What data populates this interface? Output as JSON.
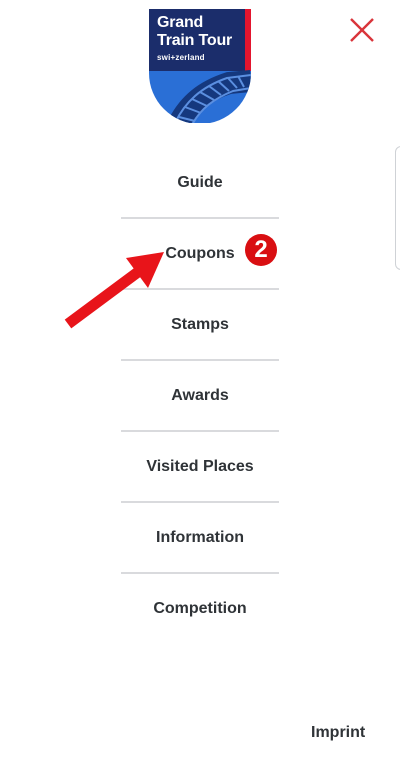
{
  "logo": {
    "line1": "Grand",
    "line2": "Train Tour",
    "sub": "swi+zerland"
  },
  "menu": [
    {
      "id": "guide",
      "label": "Guide"
    },
    {
      "id": "coupons",
      "label": "Coupons"
    },
    {
      "id": "stamps",
      "label": "Stamps"
    },
    {
      "id": "awards",
      "label": "Awards"
    },
    {
      "id": "visited-places",
      "label": "Visited Places"
    },
    {
      "id": "information",
      "label": "Information"
    },
    {
      "id": "competition",
      "label": "Competition"
    }
  ],
  "annotation": {
    "badge_number": "2"
  },
  "footer": {
    "imprint_label": "Imprint"
  },
  "colors": {
    "accent_red": "#d90f12",
    "logo_blue_dark": "#1b2d6b",
    "logo_blue_light": "#2a6fd6",
    "text": "#2f3337",
    "divider": "#d9dadd"
  },
  "icons": {
    "close": "close-icon",
    "arrow": "arrow-annotation-icon"
  }
}
